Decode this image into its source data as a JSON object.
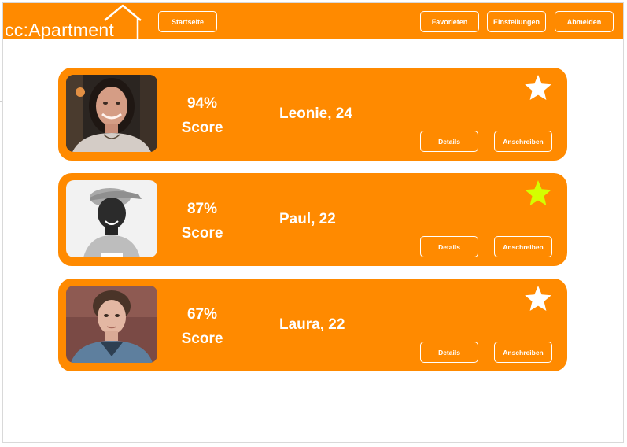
{
  "header": {
    "logo_text": "cc:Apartment",
    "nav": {
      "home": "Startseite",
      "favorites": "Favorieten",
      "settings": "Einstellungen",
      "logout": "Abmelden"
    }
  },
  "labels": {
    "score": "Score",
    "details": "Details",
    "message": "Anschreiben"
  },
  "matches": [
    {
      "score": "94%",
      "name": "Leonie, 24",
      "favorite": false
    },
    {
      "score": "87%",
      "name": "Paul, 22",
      "favorite": true
    },
    {
      "score": "67%",
      "name": "Laura, 22",
      "favorite": false
    }
  ],
  "colors": {
    "accent": "#ff8a00",
    "star_default": "#ffffff",
    "star_favorite": "#d4ff00"
  },
  "icons": {
    "logo": "house-outline-icon",
    "favorite": "star-icon"
  }
}
